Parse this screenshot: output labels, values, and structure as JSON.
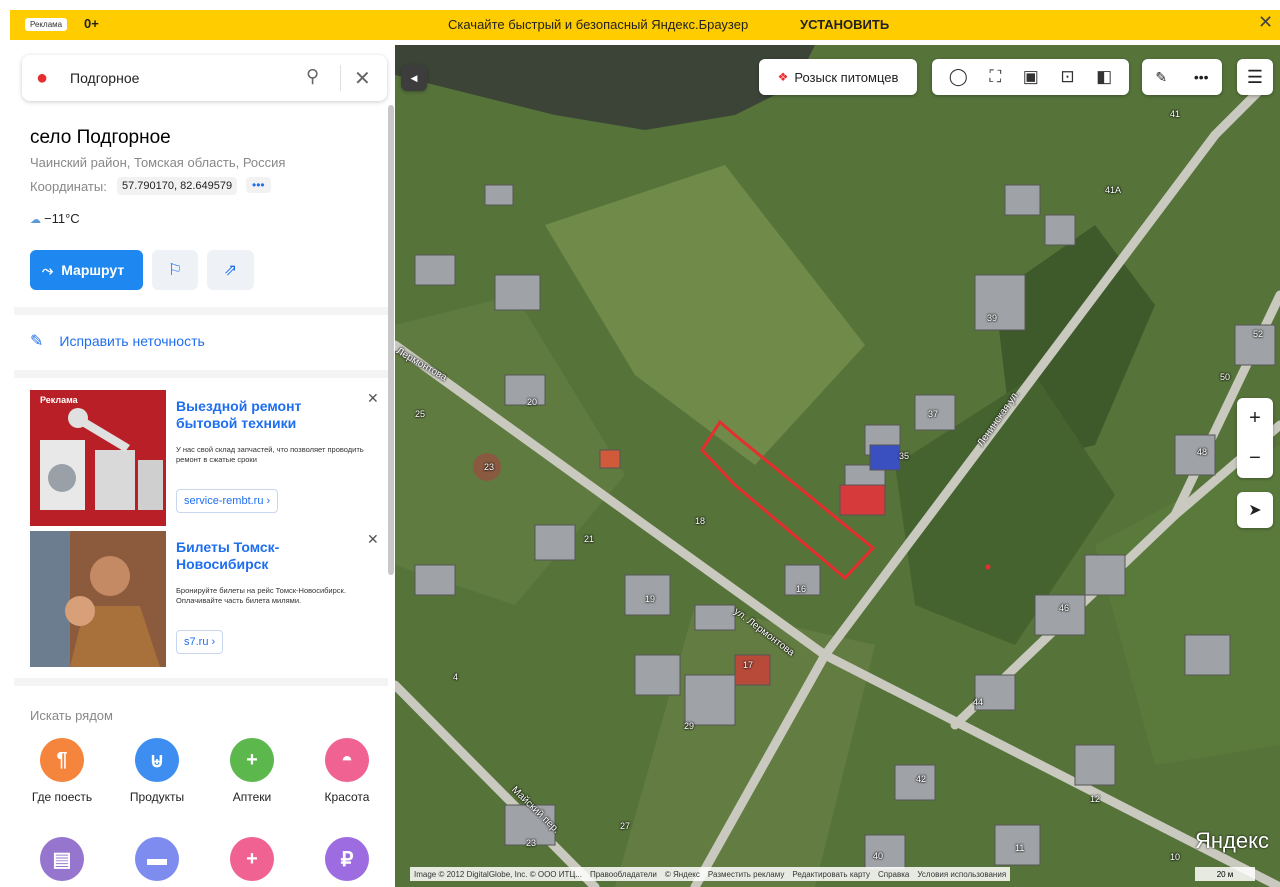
{
  "ad_banner": {
    "label": "Реклама",
    "age": "0+",
    "message": "Скачайте быстрый и безопасный Яндекс.Браузер",
    "install": "УСТАНОВИТЬ",
    "close": "✕"
  },
  "search": {
    "value": "Подгорное",
    "search_icon": "search-icon",
    "clear_icon": "close-icon"
  },
  "place": {
    "title": "село Подгорное",
    "subtitle": "Чаинский район, Томская область, Россия",
    "coords_label": "Координаты:",
    "coords_value": "57.790170, 82.649579",
    "coords_more": "•••",
    "weather": "−11°C"
  },
  "actions": {
    "route": "Маршрут",
    "fix": "Исправить неточность"
  },
  "ads": [
    {
      "tag": "Реклама",
      "title": "Выездной ремонт бытовой техники",
      "desc": "У нас свой склад запчастей, что позволяет проводить ремонт в сжатые сроки",
      "link": "service-rembt.ru ›"
    },
    {
      "title": "Билеты Томск-Новосибирск",
      "desc": "Бронируйте билеты на рейс Томск-Новосибирск. Оплачивайте часть билета милями.",
      "link": "s7.ru ›"
    }
  ],
  "nearby": {
    "title": "Искать рядом",
    "categories": [
      {
        "label": "Где поесть",
        "color": "#f5843c"
      },
      {
        "label": "Продукты",
        "color": "#3d8ef0"
      },
      {
        "label": "Аптеки",
        "color": "#5cb84c"
      },
      {
        "label": "Красота",
        "color": "#f06292"
      },
      {
        "label": "",
        "color": "#9575cd"
      },
      {
        "label": "",
        "color": "#7e8cf0"
      },
      {
        "label": "",
        "color": "#f06292"
      },
      {
        "label": "",
        "color": "#9c6ce0"
      }
    ]
  },
  "map": {
    "pets_button": "Розыск питомцев",
    "zoom_in": "+",
    "zoom_out": "−",
    "logo": "Яндекс",
    "copyright": [
      "Image © 2012 DigitalGlobe, Inc. © ООО ИТЦ...",
      "Правообладатели",
      "© Яндекс",
      "Разместить рекламу",
      "Редактировать карту",
      "Справка",
      "Условия использования"
    ],
    "scale": "20 м",
    "streets": [
      "ул. Лермонтова",
      "Ленинская ул.",
      "Майский пер.",
      "Лермонтова"
    ],
    "house_numbers": [
      "41",
      "41А",
      "39",
      "52",
      "50",
      "37",
      "35",
      "48",
      "25",
      "20",
      "23",
      "18",
      "21",
      "16",
      "19",
      "46",
      "17",
      "4",
      "29",
      "44",
      "42",
      "12",
      "27",
      "23",
      "40",
      "11",
      "10"
    ],
    "accent": "#e62e2e"
  }
}
